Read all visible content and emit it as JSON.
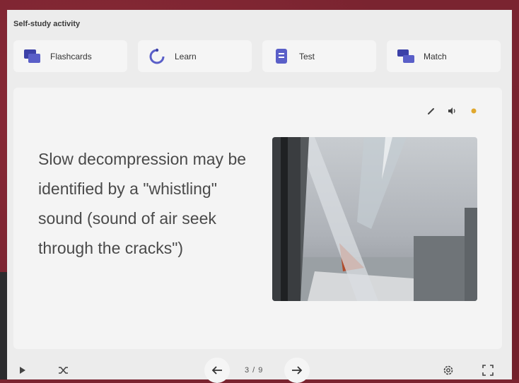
{
  "activity_title": "Self-study activity",
  "modes": [
    {
      "label": "Flashcards",
      "icon": "flashcards-icon"
    },
    {
      "label": "Learn",
      "icon": "learn-icon"
    },
    {
      "label": "Test",
      "icon": "test-icon"
    },
    {
      "label": "Match",
      "icon": "match-icon"
    }
  ],
  "card": {
    "term": "Slow decompression may be identified by a \"whistling\" sound (sound of air seek through the cracks\")",
    "tools": [
      "edit-icon",
      "audio-icon",
      "star-icon"
    ]
  },
  "navigation": {
    "counter": "3 / 9"
  },
  "colors": {
    "background": "#7a2430",
    "panel": "#ececec",
    "accent": "#5a5fc8",
    "star": "#e0a82e"
  }
}
